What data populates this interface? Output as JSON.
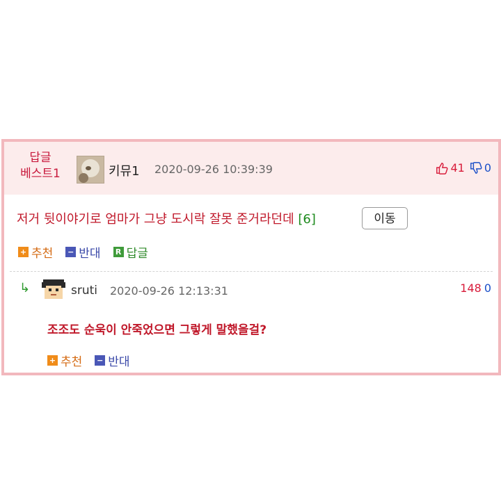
{
  "best_badge": {
    "line1": "답글",
    "line2": "베스트1"
  },
  "comment1": {
    "author": "키뮤1",
    "datetime": "2020-09-26 10:39:39",
    "likes": "41",
    "dislikes": "0",
    "text": "저거 뒷이야기로 엄마가 그냥 도시락 잘못 준거라던데",
    "reply_count": "[6]",
    "move_button": "이동",
    "actions": {
      "up": "추천",
      "down": "반대",
      "reply": "답글"
    },
    "icon_letters": {
      "plus": "+",
      "minus": "−",
      "reply": "R"
    }
  },
  "comment2": {
    "reply_arrow": "↳",
    "author": "sruti",
    "datetime": "2020-09-26 12:13:31",
    "likes": "148",
    "dislikes": "0",
    "text": "조조도 순욱이 안죽었으면 그렇게 말했을걸?",
    "actions": {
      "up": "추천",
      "down": "반대"
    },
    "icon_letters": {
      "plus": "+",
      "minus": "−"
    }
  },
  "colors": {
    "frame_border": "#f2b8bd",
    "header_bg": "#fcecec",
    "accent_red": "#c0182a",
    "like_red": "#d81b3a",
    "dislike_blue": "#1a4fc8",
    "up_orange": "#f08c1a",
    "down_blue": "#4a57b6",
    "reply_green": "#3f9b3a"
  },
  "icons": {
    "like": "thumbs-up-icon",
    "dislike": "thumbs-down-icon",
    "avatar1": "avatar",
    "avatar2": "pixel-avatar"
  }
}
